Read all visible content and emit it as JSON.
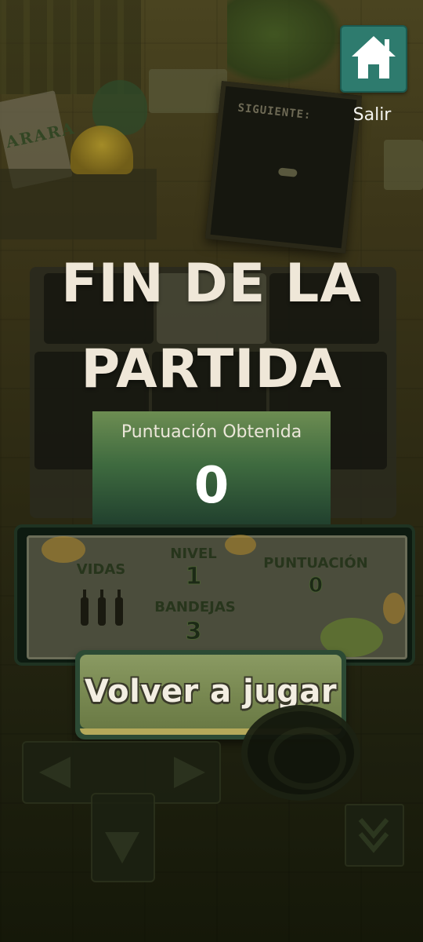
{
  "exit": {
    "label": "Salir",
    "icon": "home-icon",
    "color": "#2e7b6e"
  },
  "background": {
    "sign_text": "ARARA",
    "board_label": "SIGUIENTE:"
  },
  "title": {
    "line1": "FIN DE LA",
    "line2": "PARTIDA"
  },
  "score_panel": {
    "label": "Puntuación Obtenida",
    "value": "0"
  },
  "hud": {
    "lives_label": "VIDAS",
    "lives_count": 3,
    "level_label": "NIVEL",
    "level_value": "1",
    "trays_label": "BANDEJAS",
    "trays_value": "3",
    "score_label": "PUNTUACIÓN",
    "score_value": "0"
  },
  "replay_button": {
    "label": "Volver a jugar"
  },
  "controls": {
    "left": "arrow-left-icon",
    "right": "arrow-right-icon",
    "down": "arrow-down-icon",
    "jump": "jump-icon",
    "drop": "double-chevron-down-icon"
  },
  "colors": {
    "title": "#efe7d8",
    "panel_top": "#6d8d52",
    "panel_bottom": "#1e3c2c",
    "button": "#76864f",
    "exit": "#2e7b6e"
  }
}
